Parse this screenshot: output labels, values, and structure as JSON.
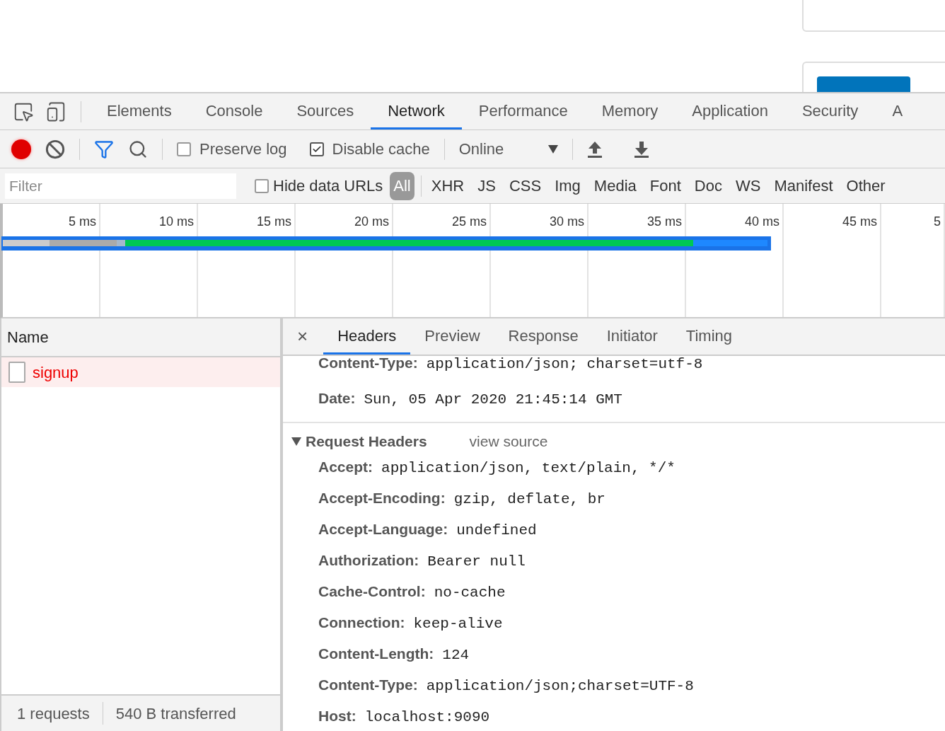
{
  "devtools": {
    "tabs": [
      {
        "label": "Elements",
        "selected": false
      },
      {
        "label": "Console",
        "selected": false
      },
      {
        "label": "Sources",
        "selected": false
      },
      {
        "label": "Network",
        "selected": true
      },
      {
        "label": "Performance",
        "selected": false
      },
      {
        "label": "Memory",
        "selected": false
      },
      {
        "label": "Application",
        "selected": false
      },
      {
        "label": "Security",
        "selected": false
      },
      {
        "label": "A",
        "selected": false
      }
    ],
    "toolbar": {
      "recording": true,
      "preserve_log": {
        "label": "Preserve log",
        "checked": false
      },
      "disable_cache": {
        "label": "Disable cache",
        "checked": true
      },
      "throttling": "Online"
    },
    "filter": {
      "placeholder": "Filter",
      "hide_data_urls": {
        "label": "Hide data URLs",
        "checked": false
      },
      "types": [
        {
          "label": "All",
          "selected": true
        },
        {
          "label": "XHR",
          "selected": false
        },
        {
          "label": "JS",
          "selected": false
        },
        {
          "label": "CSS",
          "selected": false
        },
        {
          "label": "Img",
          "selected": false
        },
        {
          "label": "Media",
          "selected": false
        },
        {
          "label": "Font",
          "selected": false
        },
        {
          "label": "Doc",
          "selected": false
        },
        {
          "label": "WS",
          "selected": false
        },
        {
          "label": "Manifest",
          "selected": false
        },
        {
          "label": "Other",
          "selected": false
        }
      ]
    },
    "timeline": {
      "ticks": [
        "5 ms",
        "10 ms",
        "15 ms",
        "20 ms",
        "25 ms",
        "30 ms",
        "35 ms",
        "40 ms",
        "45 ms",
        "5"
      ]
    },
    "requests": {
      "column": "Name",
      "rows": [
        {
          "name": "signup",
          "failed": true
        }
      ]
    },
    "details": {
      "tabs": [
        {
          "label": "Headers",
          "selected": true
        },
        {
          "label": "Preview",
          "selected": false
        },
        {
          "label": "Response",
          "selected": false
        },
        {
          "label": "Initiator",
          "selected": false
        },
        {
          "label": "Timing",
          "selected": false
        }
      ],
      "close": "×",
      "response_headers": [
        {
          "name": "Content-Type:",
          "value": "application/json; charset=utf-8"
        },
        {
          "name": "Date:",
          "value": "Sun, 05 Apr 2020 21:45:14 GMT"
        }
      ],
      "request_headers": {
        "title": "Request Headers",
        "expanded": true,
        "view_source": "view source",
        "headers": [
          {
            "name": "Accept:",
            "value": "application/json, text/plain, */*"
          },
          {
            "name": "Accept-Encoding:",
            "value": "gzip, deflate, br"
          },
          {
            "name": "Accept-Language:",
            "value": "undefined"
          },
          {
            "name": "Authorization:",
            "value": "Bearer null"
          },
          {
            "name": "Cache-Control:",
            "value": "no-cache"
          },
          {
            "name": "Connection:",
            "value": "keep-alive"
          },
          {
            "name": "Content-Length:",
            "value": "124"
          },
          {
            "name": "Content-Type:",
            "value": "application/json;charset=UTF-8"
          },
          {
            "name": "Host:",
            "value": "localhost:9090"
          }
        ]
      }
    },
    "status_bar": [
      "1 requests",
      "540 B transferred"
    ]
  }
}
